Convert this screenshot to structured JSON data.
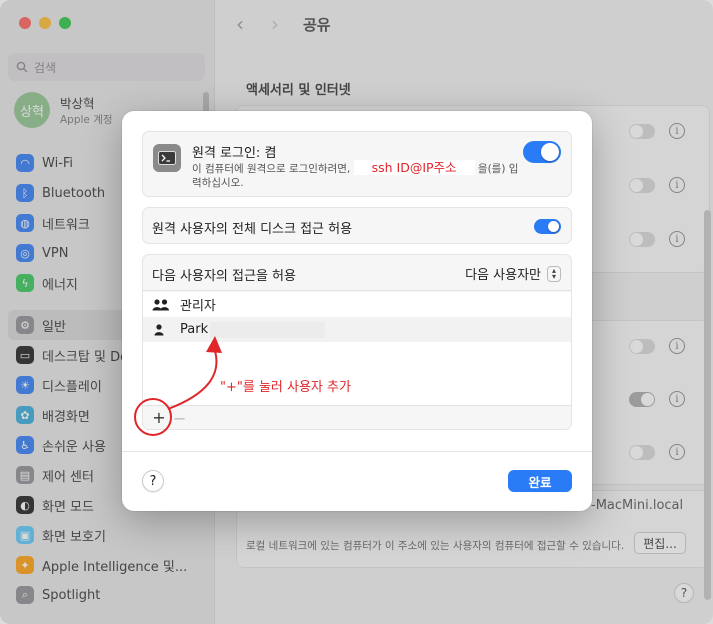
{
  "window": {
    "title": "공유"
  },
  "sidebar": {
    "search_placeholder": "검색",
    "account": {
      "avatar_text": "상혁",
      "name": "박상혁",
      "sub": "Apple 계정"
    },
    "items": [
      {
        "label": "Wi-Fi",
        "icon": "wifi-icon",
        "color": "#2f7bf5"
      },
      {
        "label": "Bluetooth",
        "icon": "bluetooth-icon",
        "color": "#2f7bf5"
      },
      {
        "label": "네트워크",
        "icon": "network-icon",
        "color": "#2f7bf5"
      },
      {
        "label": "VPN",
        "icon": "vpn-icon",
        "color": "#2f7bf5"
      },
      {
        "label": "에너지",
        "icon": "energy-icon",
        "color": "#34c759"
      },
      {
        "label": "일반",
        "icon": "gear-icon",
        "color": "#8e8e93",
        "selected": true
      },
      {
        "label": "데스크탑 및 Dock",
        "icon": "dock-icon",
        "color": "#1c1c1e"
      },
      {
        "label": "디스플레이",
        "icon": "display-icon",
        "color": "#2f7bf5"
      },
      {
        "label": "배경화면",
        "icon": "wallpaper-icon",
        "color": "#34aadc"
      },
      {
        "label": "손쉬운 사용",
        "icon": "accessibility-icon",
        "color": "#2f7bf5"
      },
      {
        "label": "제어 센터",
        "icon": "control-center-icon",
        "color": "#8e8e93"
      },
      {
        "label": "화면 모드",
        "icon": "appearance-icon",
        "color": "#1c1c1e"
      },
      {
        "label": "화면 보호기",
        "icon": "screensaver-icon",
        "color": "#5ac8fa"
      },
      {
        "label": "Apple Intelligence 및...",
        "icon": "apple-intelligence-icon",
        "color": "#ff9f0a"
      },
      {
        "label": "Spotlight",
        "icon": "spotlight-icon",
        "color": "#8e8e93"
      }
    ]
  },
  "main": {
    "section_title": "액세서리 및 인터넷",
    "hostname": "-MacMini.local",
    "local_desc": "로컬 네트워크에 있는 컴퓨터가 이 주소에 있는 사용자의 컴퓨터에 접근할 수 있습니다.",
    "edit_label": "편집...",
    "help_label": "?"
  },
  "sheet": {
    "remote_login": {
      "title": "원격 로그인: 켬",
      "desc_prefix": "이 컴퓨터에 원격으로 로그인하려면,",
      "ssh_hint": "ssh ID@IP주소",
      "desc_suffix": "을(를) 입력하십시오.",
      "enabled": true
    },
    "full_disk": {
      "label": "원격 사용자의 전체 디스크 접근 허용",
      "enabled": true
    },
    "access": {
      "label": "다음 사용자의 접근을 허용",
      "select_value": "다음 사용자만",
      "users": [
        {
          "name": "관리자",
          "icon": "group-icon"
        },
        {
          "name": "Park",
          "icon": "person-icon"
        }
      ],
      "add_label": "+",
      "remove_label": "−"
    },
    "help_label": "?",
    "done_label": "완료"
  },
  "annotation": {
    "text": "\"+\"를 눌러 사용자 추가",
    "color": "#e0262b"
  }
}
